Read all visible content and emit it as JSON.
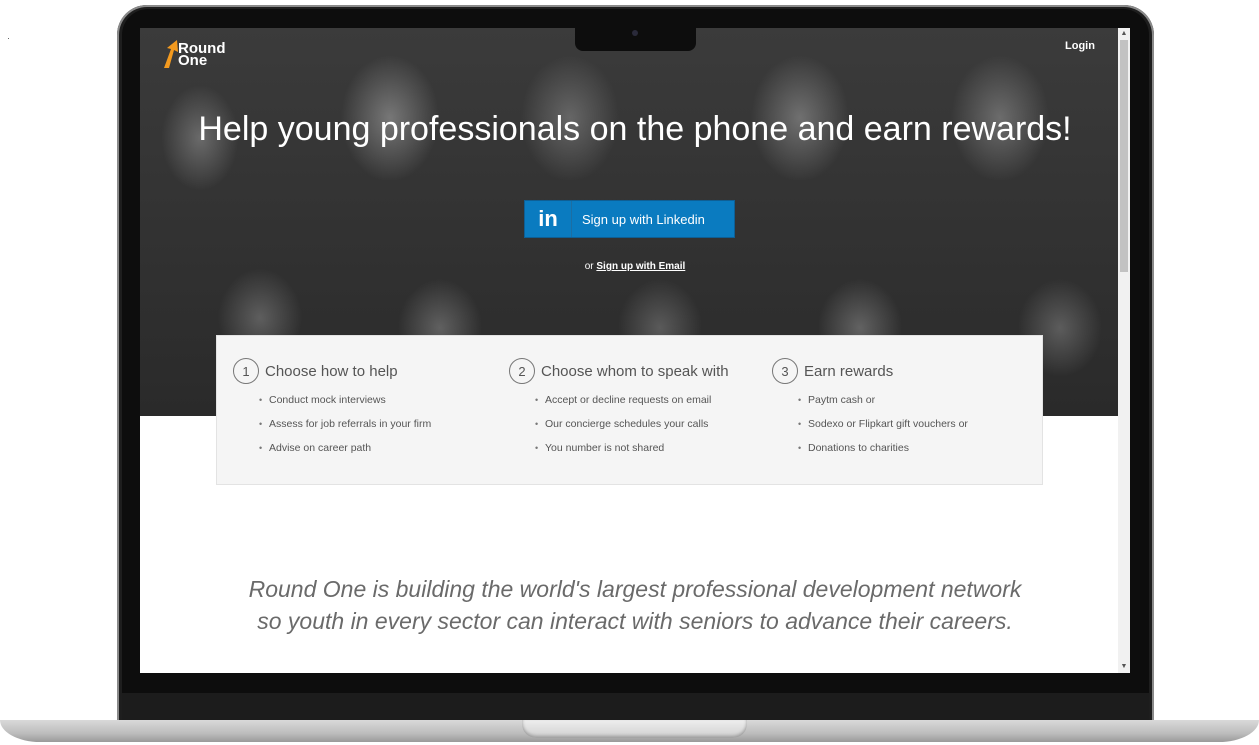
{
  "brand": {
    "logo_line1": "Round",
    "logo_line2": "One"
  },
  "header": {
    "login_label": "Login"
  },
  "hero": {
    "headline": "Help young professionals on the phone and earn rewards!",
    "linkedin_button": {
      "icon_text": "in",
      "label": "Sign up with Linkedin"
    },
    "email_prefix": "or",
    "email_link": "Sign up with Email"
  },
  "steps": [
    {
      "number": "1",
      "title": "Choose how to help",
      "items": [
        "Conduct mock interviews",
        "Assess for job referrals in your firm",
        "Advise on career path"
      ]
    },
    {
      "number": "2",
      "title": "Choose whom to speak with",
      "items": [
        "Accept or decline requests on email",
        "Our concierge schedules your calls",
        "You number is not shared"
      ]
    },
    {
      "number": "3",
      "title": "Earn rewards",
      "items": [
        "Paytm cash or",
        "Sodexo or Flipkart gift vouchers or",
        "Donations to charities"
      ]
    }
  ],
  "mission": {
    "line1": "Round One is building the world's largest professional development network",
    "line2": "so youth in every sector can interact with seniors to advance their careers."
  },
  "colors": {
    "linkedin_blue": "#0a7bc0",
    "logo_orange": "#f39a1f"
  },
  "icons": {
    "scroll_up": "▲",
    "scroll_down": "▼"
  }
}
